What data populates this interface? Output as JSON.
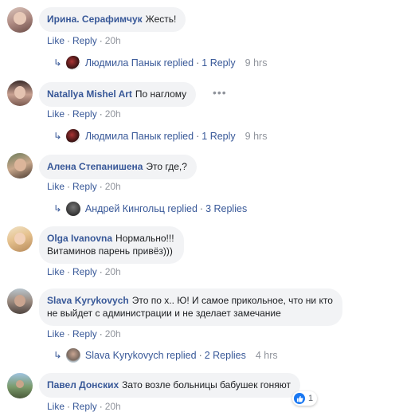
{
  "labels": {
    "like": "Like",
    "reply": "Reply",
    "sep": "·"
  },
  "comments": [
    {
      "author": "Ирина. Серафимчук",
      "text": "Жесть!",
      "time": "20h",
      "reply": {
        "name": "Людмила Панык replied",
        "count": "1 Reply",
        "time": "9 hrs"
      }
    },
    {
      "author": "Natallya Mishel Art",
      "text": "По наглому",
      "time": "20h",
      "reply": {
        "name": "Людмила Панык replied",
        "count": "1 Reply",
        "time": "9 hrs"
      }
    },
    {
      "author": "Алена Степанишена",
      "text": "Это где,?",
      "time": "20h",
      "reply": {
        "name": "Андрей Кингольц replied",
        "count": "3 Replies"
      }
    },
    {
      "author": "Olga Ivanovna",
      "text": "Нормально!!!",
      "text2": "Витаминов парень привёз)))",
      "time": "20h"
    },
    {
      "author": "Slava Kyrykovych",
      "text": "Это по х.. Ю! И самое прикольное, что ни кто",
      "text2": "не выйдет с администрации и не зделает замечание",
      "time": "20h",
      "reply": {
        "name": "Slava Kyrykovych replied",
        "count": "2 Replies",
        "time": "4 hrs"
      }
    },
    {
      "author": "Павел Донских",
      "text": "Зато возле больницы бабушек гоняют",
      "time": "20h",
      "reactions": "1"
    }
  ]
}
